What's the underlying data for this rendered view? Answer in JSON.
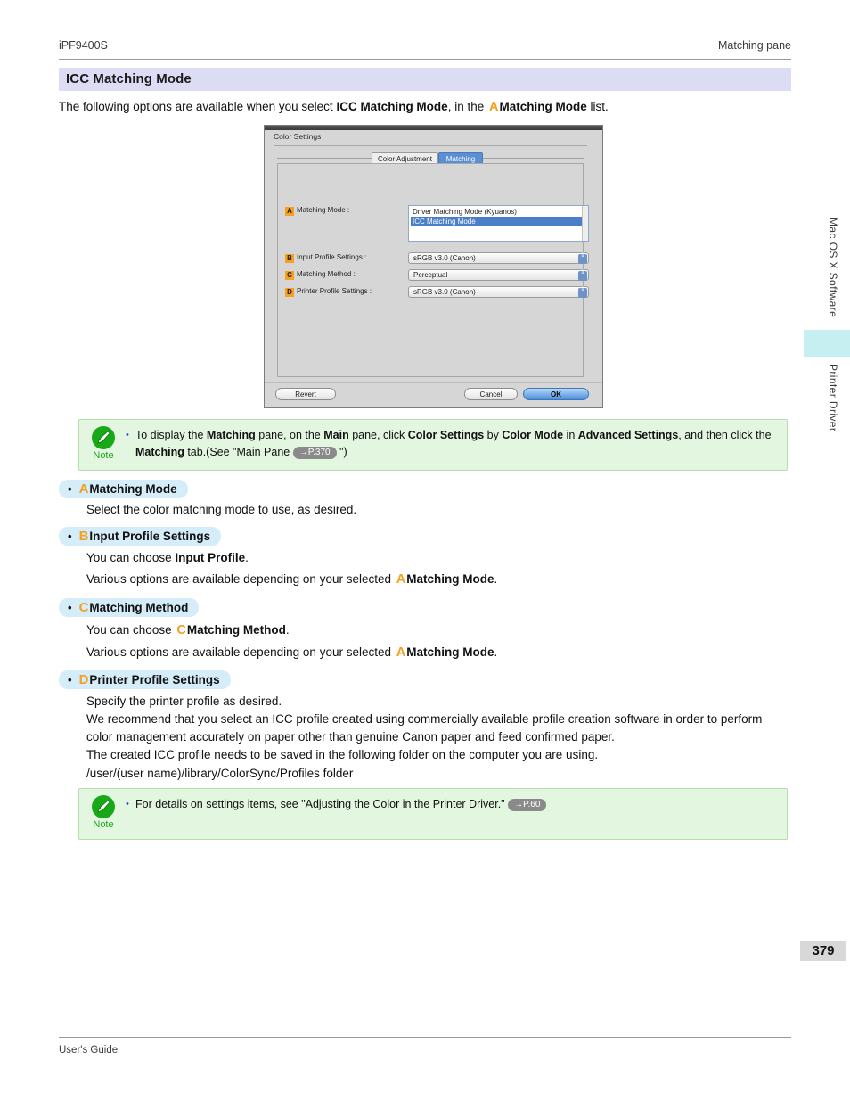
{
  "header": {
    "left": "iPF9400S",
    "right": "Matching pane"
  },
  "title": "ICC Matching Mode",
  "intro": {
    "part1": "The following options are available when you select ",
    "bold1": "ICC Matching Mode",
    "part2": ", in the ",
    "marker": "A",
    "bold2": "Matching Mode",
    "part3": " list."
  },
  "dialog": {
    "window_title": "Color Settings",
    "tabs": [
      {
        "label": "Color Adjustment",
        "active": false
      },
      {
        "label": "Matching",
        "active": true
      }
    ],
    "rows": [
      {
        "marker": "A",
        "label": "Matching Mode :"
      },
      {
        "marker": "B",
        "label": "Input Profile Settings :"
      },
      {
        "marker": "C",
        "label": "Matching Method :"
      },
      {
        "marker": "D",
        "label": "Printer Profile Settings :"
      }
    ],
    "matching_mode_options": [
      {
        "label": "Driver Matching Mode (Kyuanos)",
        "selected": false
      },
      {
        "label": "ICC Matching Mode",
        "selected": true
      }
    ],
    "input_profile_value": "sRGB v3.0 (Canon)",
    "matching_method_value": "Perceptual",
    "printer_profile_value": "sRGB v3.0 (Canon)",
    "buttons": {
      "revert": "Revert",
      "cancel": "Cancel",
      "ok": "OK"
    }
  },
  "note_top": {
    "label": "Note",
    "bullet": "•",
    "line1_a": "To display the ",
    "line1_b1": "Matching",
    "line1_c": " pane, on the ",
    "line1_b2": "Main",
    "line1_d": " pane, click ",
    "line1_b3": "Color Settings",
    "line1_e": " by ",
    "line1_b4": "Color Mode",
    "line1_f": " in ",
    "line1_b5": "Advanced Settings",
    "line1_g": ", and then click",
    "line2_a": "the ",
    "line2_b": "Matching",
    "line2_c": " tab.(See \"Main Pane ",
    "ref": "→P.370",
    "line2_d": " \")"
  },
  "sections": [
    {
      "marker": "A",
      "heading": "Matching Mode",
      "paragraphs": [
        {
          "runs": [
            {
              "t": "Select the color matching mode to use, as desired.",
              "s": "n"
            }
          ]
        }
      ]
    },
    {
      "marker": "B",
      "heading": "Input Profile Settings",
      "paragraphs": [
        {
          "runs": [
            {
              "t": "You can choose ",
              "s": "n"
            },
            {
              "t": "Input Profile",
              "s": "b"
            },
            {
              "t": ".",
              "s": "n"
            }
          ]
        },
        {
          "runs": [
            {
              "t": "Various options are available depending on your selected ",
              "s": "n"
            },
            {
              "t": "A",
              "s": "m"
            },
            {
              "t": "Matching Mode",
              "s": "b"
            },
            {
              "t": ".",
              "s": "n"
            }
          ]
        }
      ]
    },
    {
      "marker": "C",
      "heading": "Matching Method",
      "paragraphs": [
        {
          "runs": [
            {
              "t": "You can choose ",
              "s": "n"
            },
            {
              "t": "C",
              "s": "m"
            },
            {
              "t": "Matching Method",
              "s": "b"
            },
            {
              "t": ".",
              "s": "n"
            }
          ]
        },
        {
          "runs": [
            {
              "t": "Various options are available depending on your selected ",
              "s": "n"
            },
            {
              "t": "A",
              "s": "m"
            },
            {
              "t": "Matching Mode",
              "s": "b"
            },
            {
              "t": ".",
              "s": "n"
            }
          ]
        }
      ]
    },
    {
      "marker": "D",
      "heading": "Printer Profile Settings",
      "paragraphs": [
        {
          "runs": [
            {
              "t": "Specify the printer profile as desired.",
              "s": "n"
            }
          ]
        },
        {
          "runs": [
            {
              "t": "We recommend that you select an ICC profile created using commercially available profile creation software in order to perform color management accurately on paper other than genuine Canon paper and feed confirmed paper.",
              "s": "n"
            }
          ]
        },
        {
          "runs": [
            {
              "t": "The created ICC profile needs to be saved in the following folder on the computer you are using.",
              "s": "n"
            }
          ]
        },
        {
          "runs": [
            {
              "t": "/user/(user name)/library/ColorSync/Profiles folder",
              "s": "n"
            }
          ]
        }
      ]
    }
  ],
  "note_bottom": {
    "label": "Note",
    "bullet": "•",
    "text_a": "For details on settings items, see \"Adjusting the Color in the Printer Driver.\" ",
    "ref": "→P.60"
  },
  "side_tabs": {
    "upper": "Mac OS X Software",
    "lower": "Printer Driver"
  },
  "page_number": "379",
  "footer": "User's Guide",
  "colors": {
    "title_band": "#dcdcf5",
    "marker_orange": "#f5a01e",
    "section_head": "#d5ecf9",
    "note_bg": "#e2f6e0",
    "note_border": "#b6dfae",
    "note_green": "#18a818",
    "side_marker": "#c5eff0",
    "page_num_bg": "#d8d8d8",
    "list_selection": "#4a7fc8"
  }
}
